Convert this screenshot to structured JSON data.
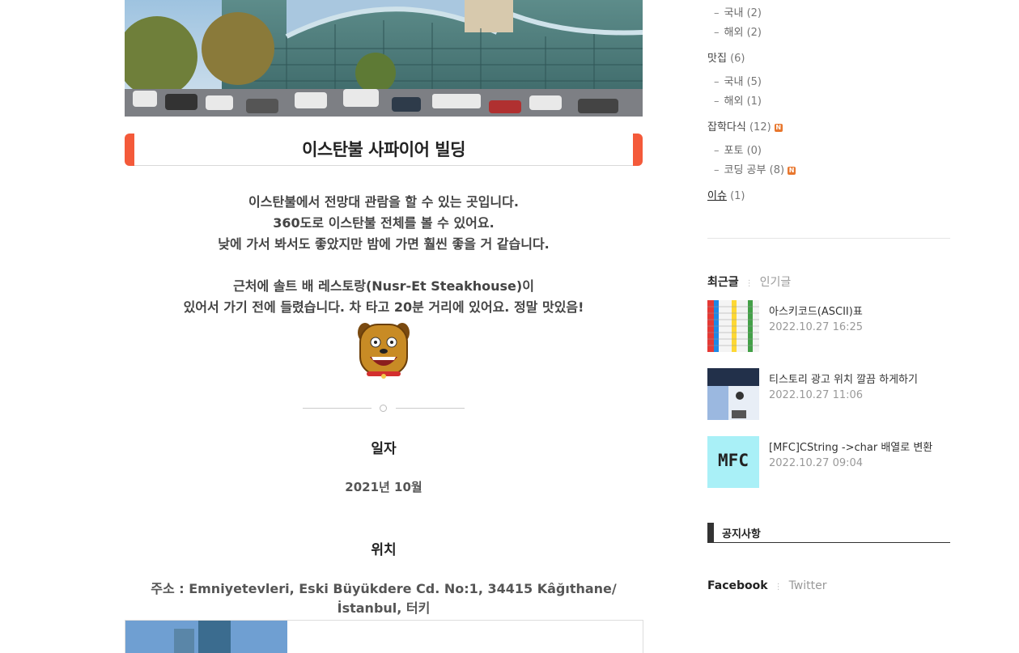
{
  "post": {
    "title": "이스탄불 사파이어 빌딩",
    "paragraphs": [
      "이스탄불에서 전망대 관람을 할 수 있는 곳입니다.",
      "360도로 이스탄불 전체를 볼 수 있어요.",
      "낮에 가서 봐서도 좋았지만 밤에 가면 훨씬 좋을 거 같습니다.",
      "근처에 솔트 배 레스토랑(Nusr-Et Steakhouse)이",
      "있어서 가기 전에 들렸습니다. 차 타고 20분 거리에 있어요. 정말 맛있음!"
    ],
    "date_heading": "일자",
    "date_value": "2021년 10월",
    "location_heading": "위치",
    "address": "주소 : Emniyetevleri, Eski Büyükdere Cd. No:1, 34415 Kâğıthane/İstanbul, 터키"
  },
  "sidebar": {
    "categories": [
      {
        "label": "국내",
        "count": "(2)",
        "level": "sub"
      },
      {
        "label": "해외",
        "count": "(2)",
        "level": "sub"
      },
      {
        "label": "맛집",
        "count": "(6)",
        "level": "main"
      },
      {
        "label": "국내",
        "count": "(5)",
        "level": "sub"
      },
      {
        "label": "해외",
        "count": "(1)",
        "level": "sub"
      },
      {
        "label": "잡학다식",
        "count": "(12)",
        "level": "main",
        "new": "N"
      },
      {
        "label": "포토",
        "count": "(0)",
        "level": "sub"
      },
      {
        "label": "코딩 공부",
        "count": "(8)",
        "level": "sub",
        "new": "N"
      },
      {
        "label": "이슈",
        "count": "(1)",
        "level": "main"
      }
    ],
    "tabs": {
      "recent": "최근글",
      "popular": "인기글"
    },
    "recent_posts": [
      {
        "title": "아스키코드(ASCII)표",
        "date": "2022.10.27 16:25"
      },
      {
        "title": "티스토리 광고 위치 깔끔 하게하기",
        "date": "2022.10.27 11:06"
      },
      {
        "title": "[MFC]CString ->char 배열로 변환",
        "date": "2022.10.27 09:04",
        "thumb_text": "MFC"
      }
    ],
    "notice_title": "공지사항",
    "social": {
      "facebook": "Facebook",
      "twitter": "Twitter"
    }
  },
  "colors": {
    "accent": "#f45a3a",
    "new_badge": "#e8772e",
    "mfc_thumb": "#a9f0f7"
  }
}
